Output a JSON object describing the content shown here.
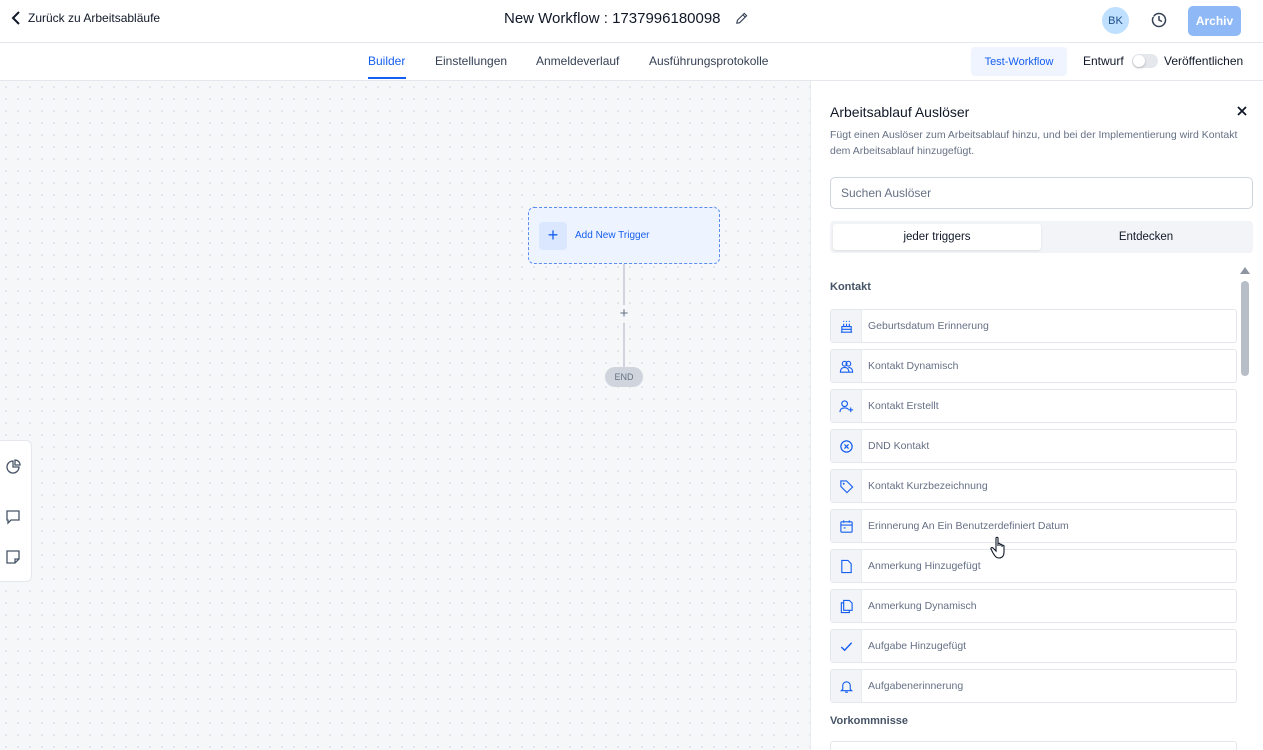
{
  "header": {
    "back_label": "Zurück zu Arbeitsabläufe",
    "workflow_title": "New Workflow : 1737996180098",
    "avatar_initials": "BK",
    "archive_label": "Archiv"
  },
  "tabs": [
    {
      "label": "Builder",
      "active": true
    },
    {
      "label": "Einstellungen",
      "active": false
    },
    {
      "label": "Anmeldeverlauf",
      "active": false
    },
    {
      "label": "Ausführungsprotokolle",
      "active": false
    }
  ],
  "tabbar_actions": {
    "test_workflow": "Test-Workflow",
    "draft_label": "Entwurf",
    "publish_label": "Veröffentlichen"
  },
  "canvas": {
    "add_trigger_label": "Add New Trigger",
    "add_step_symbol": "+",
    "end_label": "END"
  },
  "panel": {
    "title": "Arbeitsablauf Auslöser",
    "description": "Fügt einen Auslöser zum Arbeitsablauf hinzu, und bei der Implementierung wird Kontakt dem Arbeitsablauf hinzugefügt.",
    "search_placeholder": "Suchen Auslöser",
    "segments": [
      "jeder triggers",
      "Entdecken"
    ],
    "sections": [
      {
        "title": "Kontakt",
        "items": [
          {
            "label": "Geburtsdatum Erinnerung",
            "icon": "cake-icon"
          },
          {
            "label": "Kontakt Dynamisch",
            "icon": "users-icon"
          },
          {
            "label": "Kontakt Erstellt",
            "icon": "user-plus-icon"
          },
          {
            "label": "DND Kontakt",
            "icon": "x-circle-icon"
          },
          {
            "label": "Kontakt Kurzbezeichnung",
            "icon": "tag-icon"
          },
          {
            "label": "Erinnerung An Ein Benutzerdefiniert Datum",
            "icon": "calendar-icon"
          },
          {
            "label": "Anmerkung Hinzugefügt",
            "icon": "file-icon"
          },
          {
            "label": "Anmerkung Dynamisch",
            "icon": "files-icon"
          },
          {
            "label": "Aufgabe Hinzugefügt",
            "icon": "check-icon"
          },
          {
            "label": "Aufgabenerinnerung",
            "icon": "bell-icon"
          }
        ]
      },
      {
        "title": "Vorkommnisse",
        "items": []
      }
    ]
  },
  "colors": {
    "accent": "#155eef",
    "archive_button": "#8fb8f7",
    "canvas_bg": "#f6f7f9",
    "avatar_bg": "#bfe0ff"
  }
}
